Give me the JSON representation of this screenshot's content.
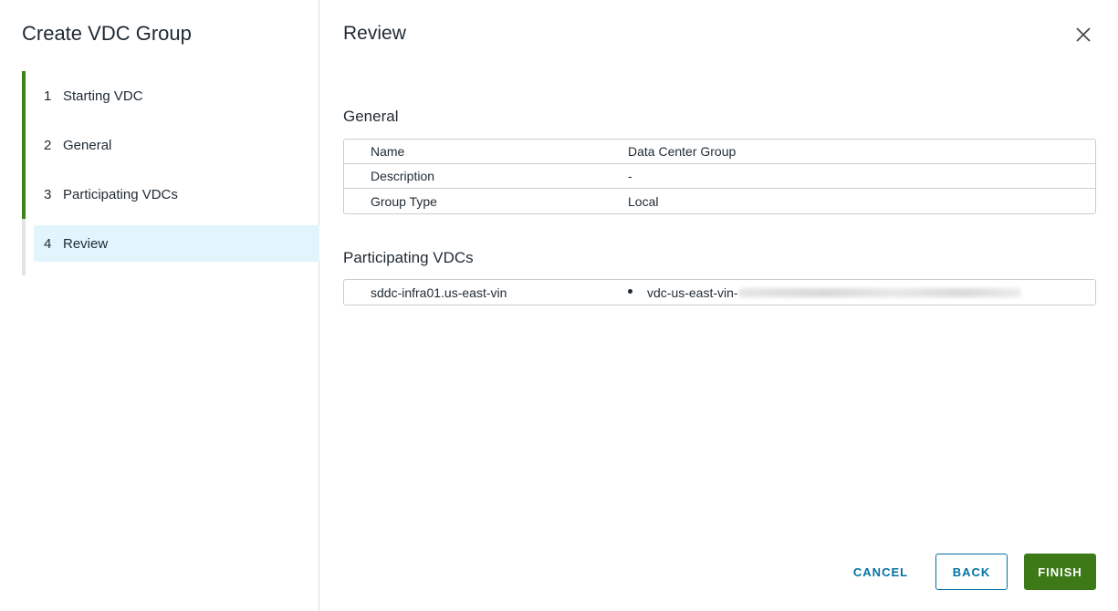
{
  "wizard": {
    "title": "Create VDC Group",
    "steps": [
      {
        "number": "1",
        "label": "Starting VDC",
        "state": "complete"
      },
      {
        "number": "2",
        "label": "General",
        "state": "complete"
      },
      {
        "number": "3",
        "label": "Participating VDCs",
        "state": "complete"
      },
      {
        "number": "4",
        "label": "Review",
        "state": "current"
      }
    ]
  },
  "review": {
    "title": "Review",
    "general": {
      "title": "General",
      "rows": [
        {
          "key": "Name",
          "value": "Data Center Group"
        },
        {
          "key": "Description",
          "value": "-"
        },
        {
          "key": "Group Type",
          "value": "Local"
        }
      ]
    },
    "participating": {
      "title": "Participating VDCs",
      "site": "sddc-infra01.us-east-vin",
      "vdc_prefix": "vdc-us-east-vin-"
    }
  },
  "footer": {
    "cancel": "CANCEL",
    "back": "BACK",
    "finish": "FINISH"
  },
  "colors": {
    "accent_green": "#3d8117",
    "link_blue": "#0072a3",
    "current_step_bg": "#e1f5fd"
  }
}
